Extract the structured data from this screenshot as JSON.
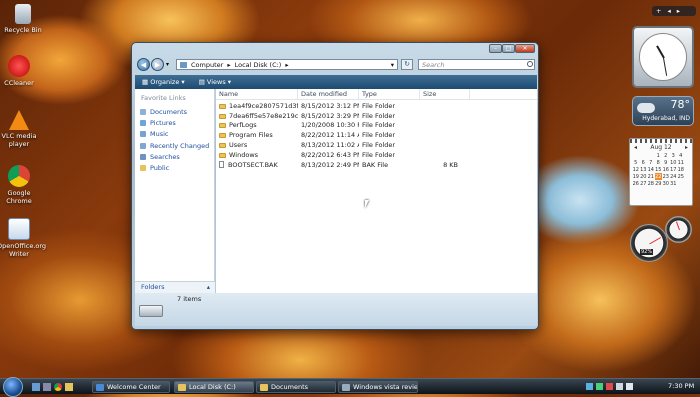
{
  "desktop_icons": [
    {
      "label": "Recycle Bin",
      "icon": "recycle-bin-icon"
    },
    {
      "label": "CCleaner",
      "icon": "ccleaner-icon"
    },
    {
      "label": "VLC media player",
      "icon": "vlc-icon"
    },
    {
      "label": "Google Chrome",
      "icon": "chrome-icon"
    },
    {
      "label": "OpenOffice.org Writer",
      "icon": "openoffice-writer-icon"
    }
  ],
  "explorer": {
    "breadcrumb": [
      "Computer",
      "Local Disk (C:)"
    ],
    "search_placeholder": "Search",
    "toolbar": {
      "organize": "Organize",
      "views": "Views"
    },
    "favorite_links_header": "Favorite Links",
    "favorite_links": [
      "Documents",
      "Pictures",
      "Music",
      "Recently Changed",
      "Searches",
      "Public"
    ],
    "folders_label": "Folders",
    "columns": [
      "Name",
      "Date modified",
      "Type",
      "Size"
    ],
    "rows": [
      {
        "name": "1ea4f9ce2807571d3fde...",
        "date": "8/15/2012 3:12 PM",
        "type": "File Folder",
        "size": ""
      },
      {
        "name": "7dea6ff5e57e8e219c09...",
        "date": "8/15/2012 3:29 PM",
        "type": "File Folder",
        "size": ""
      },
      {
        "name": "PerfLogs",
        "date": "1/20/2008 10:30 PM",
        "type": "File Folder",
        "size": ""
      },
      {
        "name": "Program Files",
        "date": "8/22/2012 11:14 AM",
        "type": "File Folder",
        "size": ""
      },
      {
        "name": "Users",
        "date": "8/13/2012 11:02 AM",
        "type": "File Folder",
        "size": ""
      },
      {
        "name": "Windows",
        "date": "8/22/2012 6:43 PM",
        "type": "File Folder",
        "size": ""
      },
      {
        "name": "BOOTSECT.BAK",
        "date": "8/13/2012 2:49 PM",
        "type": "BAK File",
        "size": "8 KB"
      }
    ],
    "item_count": "7 items"
  },
  "gadgets": {
    "weather": {
      "temp": "78°",
      "city": "Hyderabad, IND"
    },
    "calendar": {
      "month": "Aug 12",
      "selected_day": "22",
      "weeks": [
        [
          "",
          "",
          "",
          "1",
          "2",
          "3",
          "4"
        ],
        [
          "5",
          "6",
          "7",
          "8",
          "9",
          "10",
          "11"
        ],
        [
          "12",
          "13",
          "14",
          "15",
          "16",
          "17",
          "18"
        ],
        [
          "19",
          "20",
          "21",
          "22",
          "23",
          "24",
          "25"
        ],
        [
          "26",
          "27",
          "28",
          "29",
          "30",
          "31",
          ""
        ]
      ]
    },
    "cpu_meter": {
      "value": "92%"
    }
  },
  "taskbar": {
    "windows": [
      "Welcome Center",
      "Local Disk (C:)",
      "Documents",
      "Windows vista revie..."
    ],
    "clock": "7:30 PM"
  }
}
